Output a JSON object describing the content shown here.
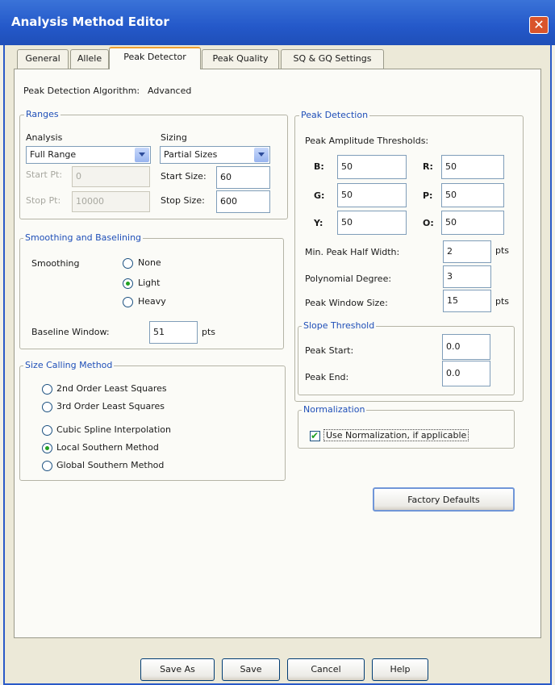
{
  "window": {
    "title": "Analysis Method Editor",
    "close_glyph": "✕"
  },
  "tabs": [
    {
      "label": "General"
    },
    {
      "label": "Allele"
    },
    {
      "label": "Peak Detector"
    },
    {
      "label": "Peak Quality"
    },
    {
      "label": "SQ & GQ Settings"
    }
  ],
  "algorithm": {
    "label": "Peak Detection Algorithm:",
    "value": "Advanced"
  },
  "ranges": {
    "title": "Ranges",
    "analysis_label": "Analysis",
    "analysis_value": "Full Range",
    "sizing_label": "Sizing",
    "sizing_value": "Partial Sizes",
    "start_pt_label": "Start Pt:",
    "start_pt_value": "0",
    "stop_pt_label": "Stop Pt:",
    "stop_pt_value": "10000",
    "start_size_label": "Start Size:",
    "start_size_value": "60",
    "stop_size_label": "Stop Size:",
    "stop_size_value": "600"
  },
  "smoothing": {
    "title": "Smoothing and Baselining",
    "smoothing_label": "Smoothing",
    "options": [
      "None",
      "Light",
      "Heavy"
    ],
    "selected": "Light",
    "baseline_label": "Baseline Window:",
    "baseline_value": "51",
    "baseline_unit": "pts"
  },
  "size_calling": {
    "title": "Size Calling Method",
    "options": [
      "2nd Order Least Squares",
      "3rd Order Least Squares",
      "Cubic Spline Interpolation",
      "Local Southern Method",
      "Global Southern Method"
    ],
    "selected": "Local Southern Method"
  },
  "peak_detection": {
    "title": "Peak Detection",
    "thresholds_label": "Peak Amplitude Thresholds:",
    "thresholds": {
      "B": {
        "label": "B:",
        "value": "50"
      },
      "R": {
        "label": "R:",
        "value": "50"
      },
      "G": {
        "label": "G:",
        "value": "50"
      },
      "P": {
        "label": "P:",
        "value": "50"
      },
      "Y": {
        "label": "Y:",
        "value": "50"
      },
      "O": {
        "label": "O:",
        "value": "50"
      }
    },
    "min_half_width_label": "Min. Peak Half Width:",
    "min_half_width_value": "2",
    "min_half_width_unit": "pts",
    "poly_degree_label": "Polynomial Degree:",
    "poly_degree_value": "3",
    "window_size_label": "Peak Window Size:",
    "window_size_value": "15",
    "window_size_unit": "pts"
  },
  "slope": {
    "title": "Slope Threshold",
    "start_label": "Peak Start:",
    "start_value": "0.0",
    "end_label": "Peak End:",
    "end_value": "0.0"
  },
  "normalization": {
    "title": "Normalization",
    "checkbox_label": "Use Normalization, if applicable",
    "checked": true
  },
  "buttons": {
    "factory_defaults": "Factory Defaults",
    "save_as": "Save As",
    "save": "Save",
    "cancel": "Cancel",
    "help": "Help"
  },
  "colors": {
    "titlebar": "#2458c9",
    "group_title": "#1f4fb8",
    "close": "#d9542c"
  }
}
